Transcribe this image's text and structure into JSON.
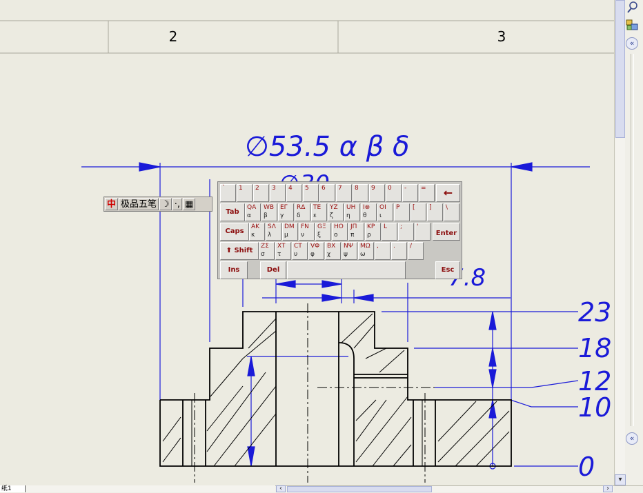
{
  "ruler": {
    "col2": "2",
    "col3": "3"
  },
  "dimensions": {
    "top_diameter": "∅53.5 α β δ",
    "second_diameter": "∅30",
    "partial_value": "7.8",
    "heights": [
      "23",
      "18",
      "12",
      "10",
      "0"
    ]
  },
  "ime": {
    "logo": "中",
    "name": "极品五笔",
    "moon": "☽",
    "punct": "·,",
    "keyboard_icon": "▦"
  },
  "keyboard": {
    "rows": [
      [
        {
          "t": "`",
          "b": ""
        },
        {
          "t": "1",
          "b": ""
        },
        {
          "t": "2",
          "b": ""
        },
        {
          "t": "3",
          "b": ""
        },
        {
          "t": "4",
          "b": ""
        },
        {
          "t": "5",
          "b": ""
        },
        {
          "t": "6",
          "b": ""
        },
        {
          "t": "7",
          "b": ""
        },
        {
          "t": "8",
          "b": ""
        },
        {
          "t": "9",
          "b": ""
        },
        {
          "t": "0",
          "b": ""
        },
        {
          "t": "-",
          "b": ""
        },
        {
          "t": "=",
          "b": ""
        }
      ],
      [
        {
          "t": "QA",
          "b": "α"
        },
        {
          "t": "WB",
          "b": "β"
        },
        {
          "t": "EΓ",
          "b": "γ"
        },
        {
          "t": "RΔ",
          "b": "δ"
        },
        {
          "t": "TE",
          "b": "ε"
        },
        {
          "t": "YZ",
          "b": "ζ"
        },
        {
          "t": "UH",
          "b": "η"
        },
        {
          "t": "I⊗",
          "b": "θ"
        },
        {
          "t": "OI",
          "b": "ι"
        },
        {
          "t": "P",
          "b": ""
        },
        {
          "t": "[",
          "b": ""
        },
        {
          "t": "]",
          "b": ""
        },
        {
          "t": "\\",
          "b": ""
        }
      ],
      [
        {
          "t": "AK",
          "b": "κ"
        },
        {
          "t": "SΛ",
          "b": "λ"
        },
        {
          "t": "DM",
          "b": "μ"
        },
        {
          "t": "FN",
          "b": "ν"
        },
        {
          "t": "GΞ",
          "b": "ξ"
        },
        {
          "t": "HO",
          "b": "ο"
        },
        {
          "t": "JΠ",
          "b": "π"
        },
        {
          "t": "KP",
          "b": "ρ"
        },
        {
          "t": "L",
          "b": ""
        },
        {
          "t": ";",
          "b": ""
        },
        {
          "t": "'",
          "b": ""
        }
      ],
      [
        {
          "t": "ZΣ",
          "b": "σ"
        },
        {
          "t": "XT",
          "b": "τ"
        },
        {
          "t": "CT",
          "b": "υ"
        },
        {
          "t": "VΦ",
          "b": "φ"
        },
        {
          "t": "BX",
          "b": "χ"
        },
        {
          "t": "NΨ",
          "b": "ψ"
        },
        {
          "t": "MΩ",
          "b": "ω"
        },
        {
          "t": ",",
          "b": ""
        },
        {
          "t": ".",
          "b": ""
        },
        {
          "t": "/",
          "b": ""
        }
      ]
    ],
    "backspace": "←",
    "tab": "Tab",
    "caps": "Caps",
    "enter": "Enter",
    "shift": "Shift",
    "ins": "Ins",
    "del": "Del",
    "esc": "Esc"
  },
  "sheet_tab": "纸1",
  "icons": {
    "search": "search-icon",
    "layers": "layers-icon",
    "collapse_up": "double-chevron-left-icon",
    "collapse_down": "double-chevron-left-icon"
  },
  "colors": {
    "dimension": "#1a1ad8",
    "outline": "#000000",
    "background": "#ecebe1"
  }
}
